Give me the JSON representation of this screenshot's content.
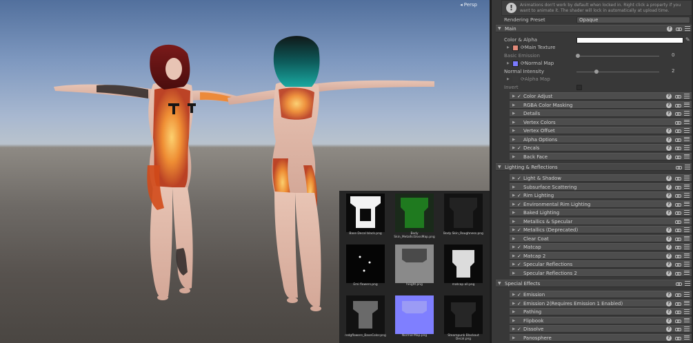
{
  "scene": {
    "perspective_label": "Persp",
    "persp_icon": "camera-icon"
  },
  "textures": [
    {
      "name": "Base Decal black.png",
      "kind": "base-decal"
    },
    {
      "name": "Body\nSkin_MetallicGlossMap.png",
      "kind": "metallic"
    },
    {
      "name": "Body Skin_Roughness.png",
      "kind": "roughness"
    },
    {
      "name": "Emi flowers.png",
      "kind": "emission"
    },
    {
      "name": "height.png",
      "kind": "height"
    },
    {
      "name": "matcap all.png",
      "kind": "matcap"
    },
    {
      "name": "redgflowers_BaseColor.png",
      "kind": "basecolor"
    },
    {
      "name": "Normal Map.png",
      "kind": "normal"
    },
    {
      "name": "Steampunk Blackout\nDecal.png",
      "kind": "steampunk"
    }
  ],
  "inspector": {
    "info_icon": "info-icon",
    "info_text": "Animations don't work by default when locked in. Right click a property if you want to animate it. The shader will lock in automatically at upload time.",
    "rendering_preset_label": "Rendering Preset",
    "rendering_preset_value": "Opaque",
    "main_section": "Main",
    "color_alpha_label": "Color & Alpha",
    "main_texture_label": "Main Texture",
    "basic_emission_label": "Basic Emission",
    "basic_emission_value": "0",
    "normal_map_label": "Normal Map",
    "normal_intensity_label": "Normal Intensity",
    "normal_intensity_value": "2",
    "alpha_map_label": "Alpha Map",
    "invert_label": "Invert",
    "main_subsections": [
      {
        "title": "Color Adjust",
        "checked": true,
        "help": true,
        "link": true,
        "menu": true
      },
      {
        "title": "RGBA Color Masking",
        "checked": false,
        "help": true,
        "link": true,
        "menu": true
      },
      {
        "title": "Details",
        "checked": false,
        "help": true,
        "link": true,
        "menu": true
      },
      {
        "title": "Vertex Colors",
        "checked": false,
        "help": false,
        "link": true,
        "menu": true
      },
      {
        "title": "Vertex Offset",
        "checked": false,
        "help": true,
        "link": true,
        "menu": true
      },
      {
        "title": "Alpha Options",
        "checked": false,
        "help": true,
        "link": true,
        "menu": true
      },
      {
        "title": "Decals",
        "checked": true,
        "help": true,
        "link": true,
        "menu": true
      },
      {
        "title": "Back Face",
        "checked": false,
        "help": true,
        "link": true,
        "menu": true
      }
    ],
    "lighting_section": "Lighting & Reflections",
    "lighting_subsections": [
      {
        "title": "Light & Shadow",
        "checked": true,
        "help": true,
        "link": true,
        "menu": true
      },
      {
        "title": "Subsurface Scattering",
        "checked": false,
        "help": true,
        "link": true,
        "menu": true
      },
      {
        "title": "Rim Lighting",
        "checked": true,
        "help": true,
        "link": true,
        "menu": true
      },
      {
        "title": "Environmental Rim Lighting",
        "checked": true,
        "help": true,
        "link": true,
        "menu": true
      },
      {
        "title": "Baked Lighting",
        "checked": false,
        "help": true,
        "link": true,
        "menu": true
      },
      {
        "title": "Metallics & Specular",
        "checked": false,
        "help": false,
        "link": true,
        "menu": true
      },
      {
        "title": "Metallics (Deprecated)",
        "checked": true,
        "help": true,
        "link": true,
        "menu": true
      },
      {
        "title": "Clear Coat",
        "checked": false,
        "help": true,
        "link": true,
        "menu": true
      },
      {
        "title": "Matcap",
        "checked": true,
        "help": true,
        "link": true,
        "menu": true
      },
      {
        "title": "Matcap 2",
        "checked": true,
        "help": true,
        "link": true,
        "menu": true
      },
      {
        "title": "Specular Reflections",
        "checked": true,
        "help": true,
        "link": true,
        "menu": true
      },
      {
        "title": "Specular Reflections 2",
        "checked": false,
        "help": true,
        "link": true,
        "menu": true
      }
    ],
    "special_section": "Special Effects",
    "special_subsections": [
      {
        "title": "Emission",
        "checked": true,
        "help": true,
        "link": true,
        "menu": true
      },
      {
        "title": "Emission 2(Requires Emission 1 Enabled)",
        "checked": true,
        "help": true,
        "link": true,
        "menu": true
      },
      {
        "title": "Pathing",
        "checked": false,
        "help": true,
        "link": true,
        "menu": true
      },
      {
        "title": "Flipbook",
        "checked": false,
        "help": true,
        "link": true,
        "menu": true
      },
      {
        "title": "Dissolve",
        "checked": true,
        "help": true,
        "link": true,
        "menu": true
      },
      {
        "title": "Panosphere",
        "checked": false,
        "help": true,
        "link": true,
        "menu": true
      }
    ],
    "colors": {
      "accent_normal_map": "#7b7bff",
      "main_texture_icon": "#e28a7a",
      "color_swatch": "#fdfdfd"
    }
  }
}
